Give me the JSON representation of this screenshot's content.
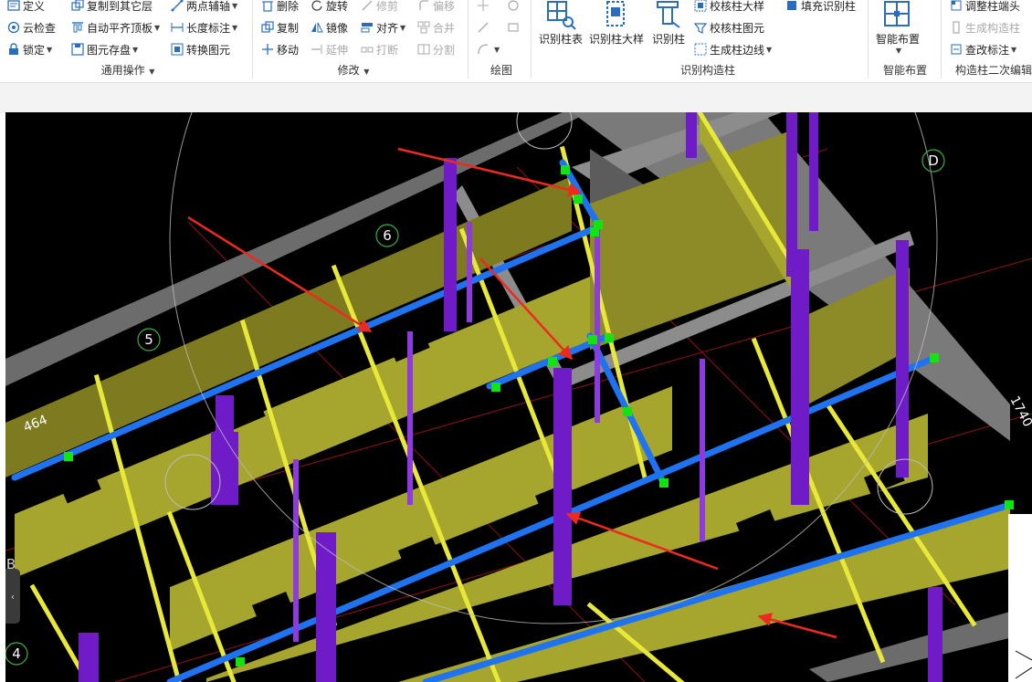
{
  "ribbon": {
    "groups": {
      "common": {
        "label": "通用操作",
        "items": {
          "define": "定义",
          "cloud_check": "云检查",
          "lock": "锁定",
          "copy_to_layer": "复制到其它层",
          "auto_align_top": "自动平齐顶板",
          "save_element": "图元存盘",
          "two_point_axis": "两点辅轴",
          "length_dim": "长度标注",
          "convert_element": "转换图元"
        }
      },
      "modify": {
        "label": "修改",
        "items": {
          "delete": "删除",
          "rotate": "旋转",
          "trim": "修剪",
          "offset": "偏移",
          "copy": "复制",
          "mirror": "镜像",
          "align": "对齐",
          "merge": "合并",
          "move": "移动",
          "extend": "延伸",
          "break": "打断",
          "split": "分割"
        }
      },
      "draw": {
        "label": "绘图"
      },
      "identify": {
        "label": "识别构造柱",
        "items": {
          "id_table": "识别柱表",
          "id_detail": "识别柱大样",
          "id_column": "识别柱",
          "check_detail": "校核柱大样",
          "check_element": "校核柱图元",
          "gen_edge": "生成柱边线",
          "fill_id": "填充识别柱"
        }
      },
      "smart": {
        "label": "智能布置",
        "items": {
          "smart_place": "智能布置"
        }
      },
      "secondary": {
        "label": "构造柱二次编辑",
        "items": {
          "adjust_end": "调整柱端头",
          "gen_column": "生成构造柱",
          "edit_dim": "查改标注"
        }
      }
    }
  },
  "viewport": {
    "axis_labels": {
      "d": "D",
      "six": "6",
      "five": "5",
      "four": "4",
      "b": "B"
    },
    "dims": {
      "left": "464",
      "right": "1740"
    },
    "colors": {
      "wall": "#a6a52d",
      "wall_edge": "#e8e83a",
      "beam": "#2073f0",
      "column": "#6f1bc8",
      "grip": "#13e313",
      "arrow": "#ee2a1f",
      "slab": "#7a7a7a"
    }
  },
  "icons": {
    "sidebar_handle": "‹"
  }
}
